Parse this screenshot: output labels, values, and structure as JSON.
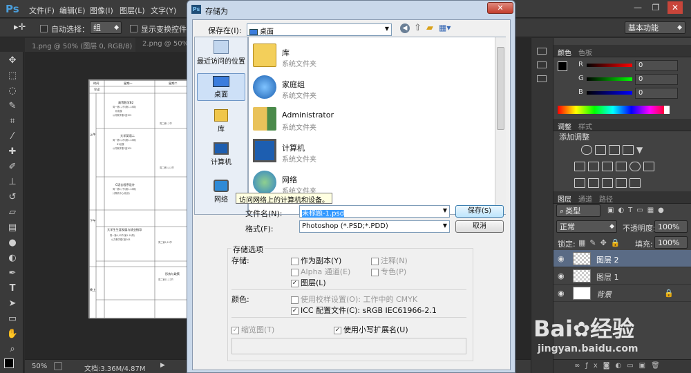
{
  "app": {
    "logo": "Ps"
  },
  "menu": [
    "文件(F)",
    "编辑(E)",
    "图像(I)",
    "图层(L)",
    "文字(Y)"
  ],
  "options_bar": {
    "auto_select_label": "自动选择：",
    "auto_select_value": "组",
    "show_transform_label": "显示变换控件",
    "workspace": "基本功能"
  },
  "doc_tabs": [
    "1.png @ 50% (图层 0, RGB/8)",
    "2.png @ 50% ("
  ],
  "status": {
    "zoom": "50%",
    "doc_size": "文档:3.36M/4.87M"
  },
  "dialog": {
    "title": "存储为",
    "save_in_label": "保存在(I):",
    "save_in_value": "桌面",
    "places": [
      "最近访问的位置",
      "桌面",
      "库",
      "计算机",
      "网络"
    ],
    "tooltip": "访问网络上的计算机和设备。",
    "files": [
      {
        "name": "库",
        "type": "系统文件夹",
        "icon": "library-folder-icon"
      },
      {
        "name": "家庭组",
        "type": "系统文件夹",
        "icon": "homegroup-icon"
      },
      {
        "name": "Administrator",
        "type": "系统文件夹",
        "icon": "user-folder-icon"
      },
      {
        "name": "计算机",
        "type": "系统文件夹",
        "icon": "computer-icon"
      },
      {
        "name": "网络",
        "type": "系统文件夹",
        "icon": "network-icon"
      }
    ],
    "filename_label": "文件名(N):",
    "filename_value": "未标题-1.psd",
    "format_label": "格式(F):",
    "format_value": "Photoshop (*.PSD;*.PDD)",
    "save_button": "保存(S)",
    "cancel_button": "取消",
    "save_options_title": "存储选项",
    "save_label": "存储:",
    "as_copy": "作为副本(Y)",
    "notes": "注释(N)",
    "alpha": "Alpha 通道(E)",
    "spot": "专色(P)",
    "layers": "图层(L)",
    "color_label": "颜色:",
    "proof_setup": "使用校样设置(O):",
    "proof_value": "工作中的 CMYK",
    "icc_profile": "ICC 配置文件(C):",
    "icc_value": "sRGB IEC61966-2.1",
    "thumbnail": "缩览图(T)",
    "lowercase_ext": "使用小写扩展名(U)",
    "checks": {
      "as_copy": false,
      "notes": false,
      "alpha": false,
      "spot": false,
      "layers": true,
      "proof": false,
      "icc": true,
      "thumbnail": true,
      "lowercase": true
    }
  },
  "color_panel": {
    "tabs": [
      "颜色",
      "色板"
    ],
    "channels": [
      {
        "label": "R",
        "value": "0"
      },
      {
        "label": "G",
        "value": "0"
      },
      {
        "label": "B",
        "value": "0"
      }
    ]
  },
  "adjust_panel": {
    "tabs": [
      "调整",
      "样式"
    ],
    "title": "添加调整"
  },
  "layers_panel": {
    "tabs": [
      "图层",
      "通道",
      "路径"
    ],
    "filter": "类型",
    "blend_mode": "正常",
    "opacity_label": "不透明度:",
    "opacity_value": "100%",
    "lock_label": "锁定:",
    "fill_label": "填充:",
    "fill_value": "100%",
    "layers": [
      {
        "name": "图层 2",
        "selected": true
      },
      {
        "name": "图层 1",
        "selected": false
      },
      {
        "name": "背景",
        "selected": false
      }
    ]
  },
  "watermark": {
    "brand": "Bai",
    "brand2": "经验",
    "url": "jingyan.baidu.com"
  },
  "document": {
    "header": [
      "时间",
      "星期一",
      "星期二"
    ],
    "rows": [
      "早读",
      "上午",
      "下午",
      "晚上"
    ],
    "courses": [
      "高等数学B2",
      "大学英语二",
      "C语言程序设计",
      "大学生生涯发展与就业指导",
      "形势与政策"
    ]
  }
}
